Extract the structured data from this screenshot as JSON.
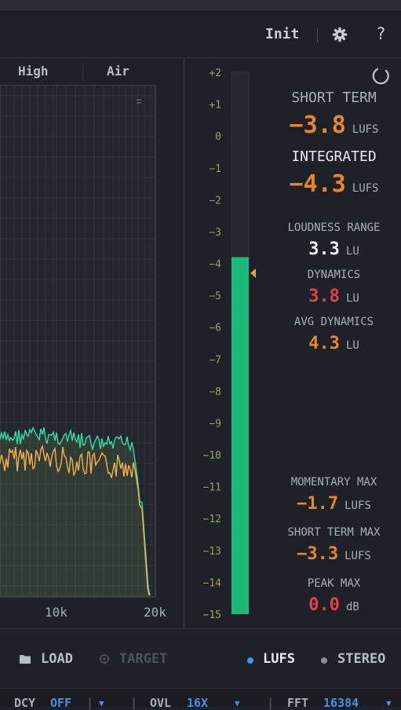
{
  "header": {
    "init_label": "Init",
    "help_label": "?"
  },
  "bands": {
    "high": "High",
    "air": "Air"
  },
  "spectrum": {
    "x_labels": [
      "10k",
      "20k"
    ]
  },
  "meter": {
    "scale": [
      "+2",
      "+1",
      "0",
      "−1",
      "−2",
      "−3",
      "−4",
      "−5",
      "−6",
      "−7",
      "−8",
      "−9",
      "−10",
      "−11",
      "−12",
      "−13",
      "−14",
      "−15"
    ],
    "level_lufs": -3.8,
    "target_marker_lufs": -4.3,
    "range": [
      2,
      -15
    ],
    "bar_color": "#1db97a"
  },
  "readings": {
    "short_term": {
      "label": "SHORT TERM",
      "value": "−3.8",
      "unit": "LUFS"
    },
    "integrated": {
      "label": "INTEGRATED",
      "value": "−4.3",
      "unit": "LUFS"
    },
    "loudness_range": {
      "label": "LOUDNESS RANGE",
      "value": "3.3",
      "unit": "LU"
    },
    "dynamics": {
      "label": "DYNAMICS",
      "value": "3.8",
      "unit": "LU"
    },
    "avg_dynamics": {
      "label": "AVG DYNAMICS",
      "value": "4.3",
      "unit": "LU"
    },
    "momentary_max": {
      "label": "MOMENTARY MAX",
      "value": "−1.7",
      "unit": "LUFS"
    },
    "short_term_max": {
      "label": "SHORT TERM MAX",
      "value": "−3.3",
      "unit": "LUFS"
    },
    "peak_max": {
      "label": "PEAK MAX",
      "value": "0.0",
      "unit": "dB"
    }
  },
  "colors": {
    "orange": "#e8872a",
    "red": "#e0424a",
    "white": "#f2f3f5",
    "green": "#1db97a",
    "blue": "#4a90e2"
  },
  "footer": {
    "load": "LOAD",
    "target": "TARGET",
    "lufs": "LUFS",
    "stereo": "STEREO"
  },
  "status": {
    "dcy_label": "DCY",
    "dcy_value": "OFF",
    "ovl_label": "OVL",
    "ovl_value": "16X",
    "fft_label": "FFT",
    "fft_value": "16384"
  }
}
